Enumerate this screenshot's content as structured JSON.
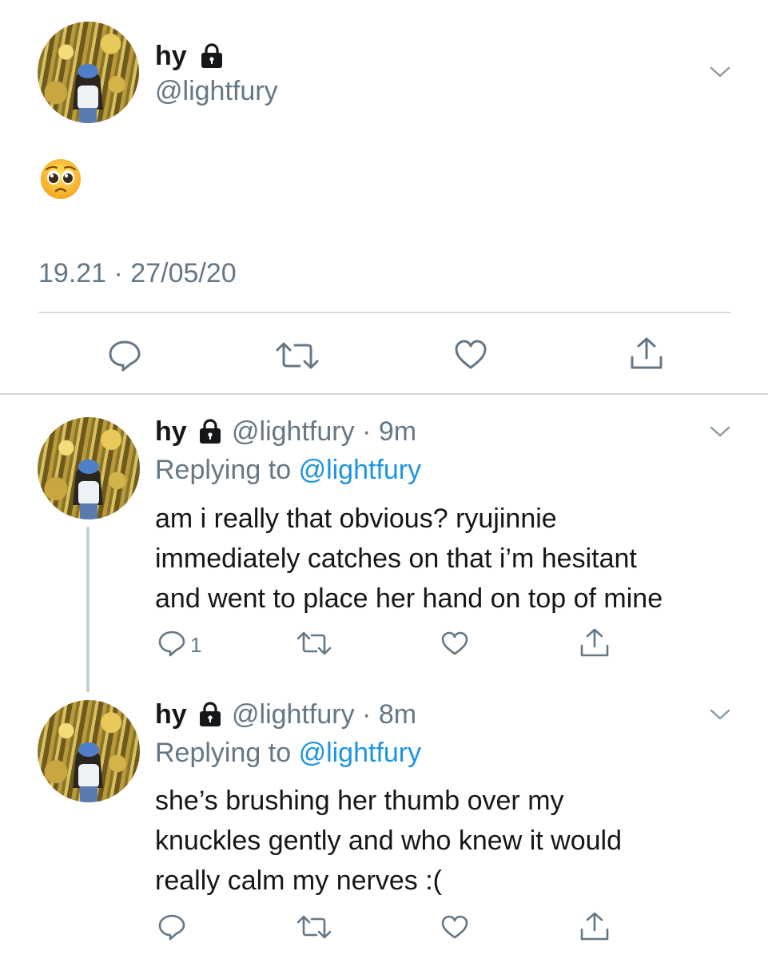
{
  "main_tweet": {
    "display_name": "hy",
    "handle": "@lightfury",
    "content_emoji": "pleading-face",
    "timestamp": "19.21 · 27/05/20"
  },
  "replies": [
    {
      "display_name": "hy",
      "handle": "@lightfury",
      "time": "9m",
      "replying_prefix": "Replying to",
      "replying_handle": "@lightfury",
      "text_lines": [
        "am i really that obvious? ryujinnie",
        "immediately catches on that i’m hesitant",
        "and went to place her hand on top of mine"
      ],
      "reply_count": "1"
    },
    {
      "display_name": "hy",
      "handle": "@lightfury",
      "time": "8m",
      "replying_prefix": "Replying to",
      "replying_handle": "@lightfury",
      "text_lines": [
        "she’s brushing her thumb over my",
        "knuckles gently and who knew it would",
        "really calm my nerves :("
      ],
      "reply_count": ""
    }
  ],
  "separator": "·",
  "icons": [
    "lock-icon",
    "chevron-down-icon",
    "reply-icon",
    "retweet-icon",
    "like-icon",
    "share-icon",
    "pleading-face-emoji"
  ],
  "colors": {
    "text": "#14171a",
    "muted": "#657786",
    "link": "#1b95e0",
    "rule": "#d4d9de"
  }
}
